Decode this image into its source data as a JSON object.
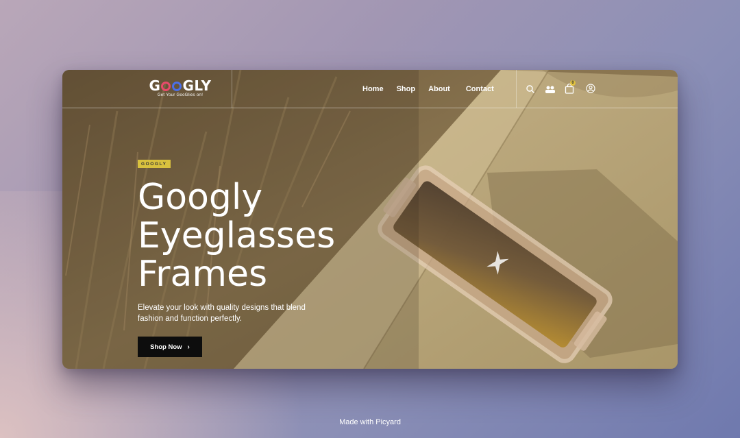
{
  "brand": {
    "name": "GOOGLY",
    "tagline": "Get Your GooGlies on!"
  },
  "nav": {
    "items": [
      {
        "label": "Home"
      },
      {
        "label": "Shop"
      },
      {
        "label": "About"
      },
      {
        "label": "Contact"
      }
    ]
  },
  "header_icons": [
    "search-icon",
    "account-group-icon",
    "shopping-bag-icon",
    "user-icon"
  ],
  "cart": {
    "count": "0"
  },
  "hero": {
    "tag": "GOOGLY",
    "title_lines": [
      "Googly",
      "Eyeglasses",
      "Frames"
    ],
    "subtitle": "Elevate your look with quality designs that blend fashion and function perfectly.",
    "cta_label": "Shop Now",
    "cta_icon": "chevron-right-icon"
  },
  "footer": {
    "credit": "Made with Picyard"
  },
  "colors": {
    "tag_bg": "#d8c13e",
    "cta_bg": "#0d0d0d",
    "badge_bg": "#e2c340"
  }
}
